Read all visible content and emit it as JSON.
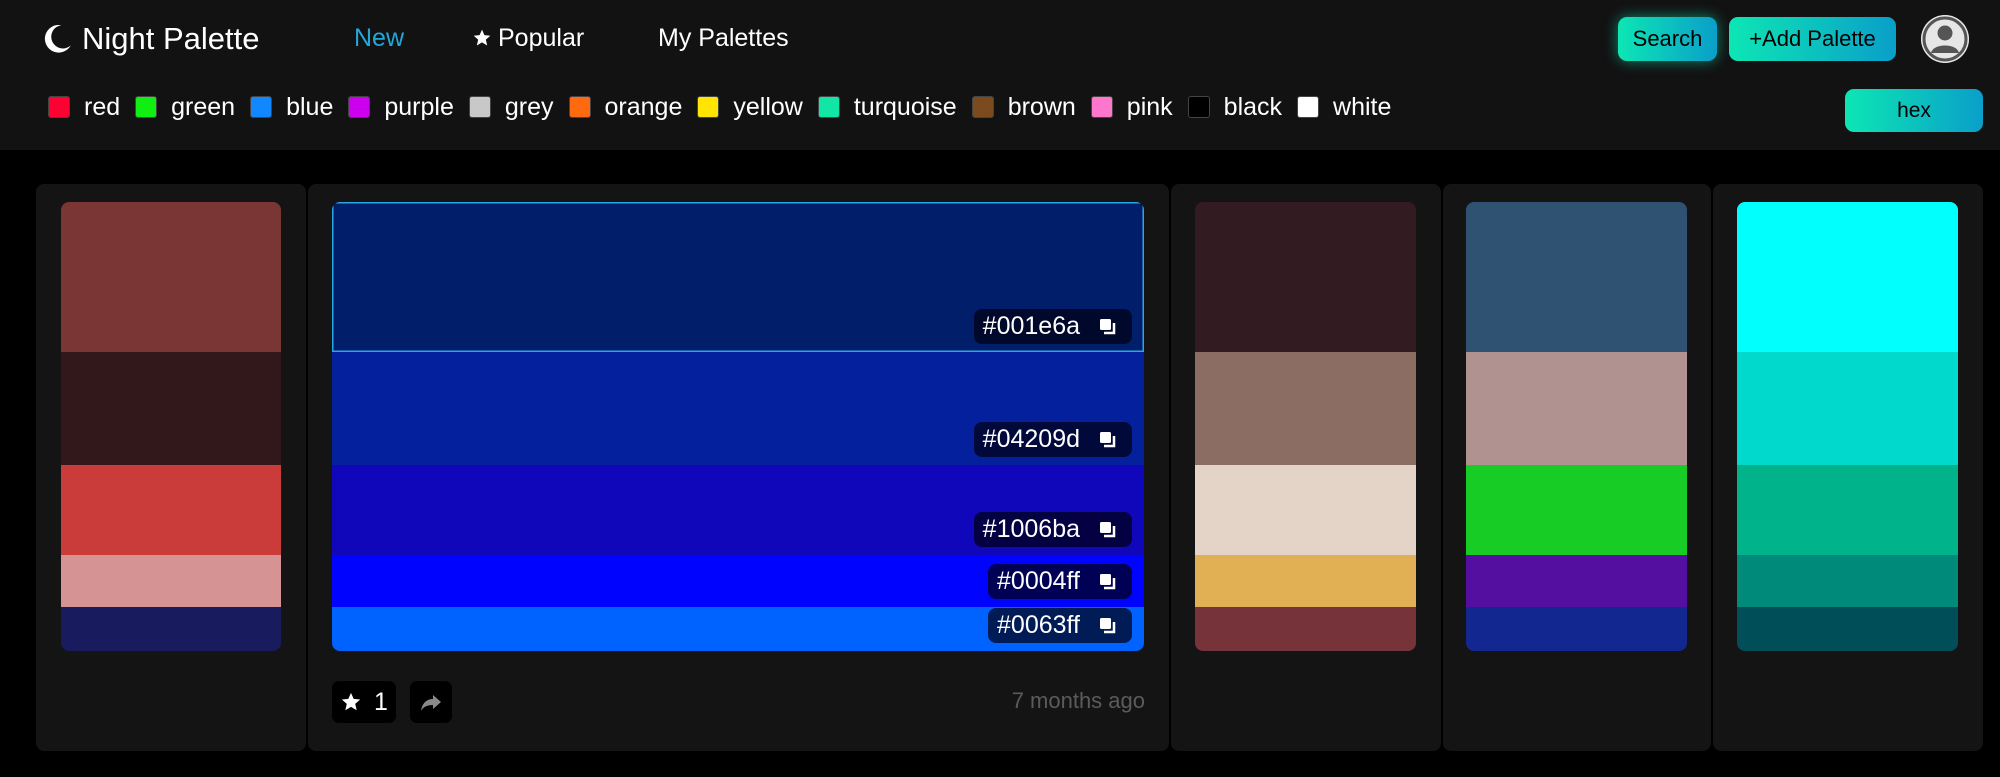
{
  "app": {
    "title": "Night Palette",
    "icon": "moon-icon"
  },
  "nav": {
    "new": "New",
    "popular": "Popular",
    "my_palettes": "My Palettes",
    "active": "New",
    "active_color": "#21a7d8"
  },
  "header_buttons": {
    "search": "Search",
    "add_palette": "+Add Palette",
    "hex": "hex"
  },
  "color_filters": [
    {
      "label": "red",
      "swatch": "#ff0033"
    },
    {
      "label": "green",
      "swatch": "#11ee11"
    },
    {
      "label": "blue",
      "swatch": "#1188ff"
    },
    {
      "label": "purple",
      "swatch": "#cc00ee"
    },
    {
      "label": "grey",
      "swatch": "#c8c8c8"
    },
    {
      "label": "orange",
      "swatch": "#ff6a11"
    },
    {
      "label": "yellow",
      "swatch": "#ffe500"
    },
    {
      "label": "turquoise",
      "swatch": "#11e6a6"
    },
    {
      "label": "brown",
      "swatch": "#7b4a1e"
    },
    {
      "label": "pink",
      "swatch": "#ff77cc"
    },
    {
      "label": "black",
      "swatch": "#000000"
    },
    {
      "label": "white",
      "swatch": "#ffffff"
    }
  ],
  "palettes": [
    {
      "colors": [
        "#7a3634",
        "#33181b",
        "#c93c3a",
        "#d69394",
        "#181b5e"
      ]
    },
    {
      "colors": [
        "#001e6a",
        "#04209d",
        "#1006ba",
        "#0004ff",
        "#0063ff"
      ]
    },
    {
      "colors": [
        "#321b21",
        "#8c6d63",
        "#e4d4c8",
        "#e1b055",
        "#76343a"
      ]
    },
    {
      "colors": [
        "#2f5273",
        "#b09290",
        "#17cd25",
        "#540fa1",
        "#12278f"
      ]
    },
    {
      "colors": [
        "#00fffd",
        "#00d9cb",
        "#00b38a",
        "#008a7a",
        "#004f58"
      ]
    }
  ],
  "expanded_palette": {
    "colors": [
      "#001e6a",
      "#04209d",
      "#1006ba",
      "#0004ff",
      "#0063ff"
    ],
    "hex_labels": [
      "#001e6a",
      "#04209d",
      "#1006ba",
      "#0004ff",
      "#0063ff"
    ],
    "star_count": "1",
    "time_ago": "7 months ago"
  },
  "accent": "#0de6b4"
}
